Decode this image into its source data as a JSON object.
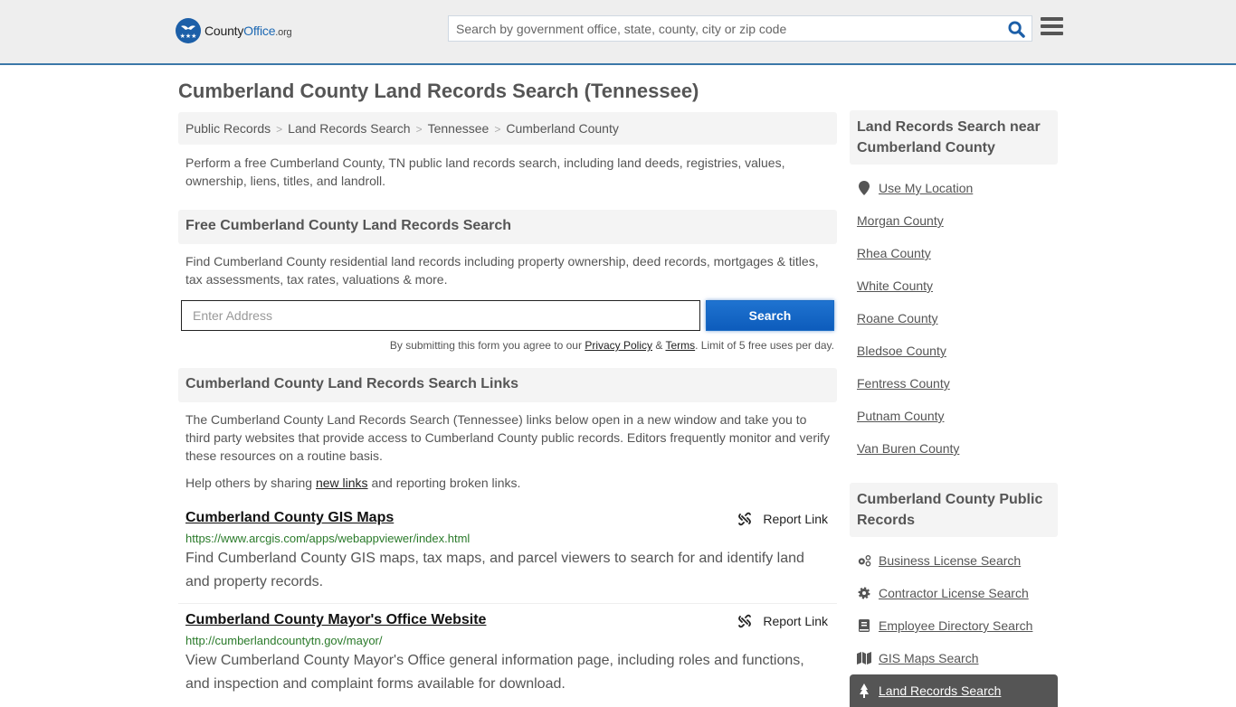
{
  "header": {
    "logo": {
      "county": "County",
      "office": "Office",
      "org": ".org"
    },
    "search_placeholder": "Search by government office, state, county, city or zip code",
    "search_icon": "search-icon",
    "menu_icon": "hamburger-menu-icon"
  },
  "page_title": "Cumberland County Land Records Search (Tennessee)",
  "breadcrumb": [
    {
      "label": "Public Records"
    },
    {
      "label": "Land Records Search"
    },
    {
      "label": "Tennessee"
    },
    {
      "label": "Cumberland County"
    }
  ],
  "intro": "Perform a free Cumberland County, TN public land records search, including land deeds, registries, values, ownership, liens, titles, and landroll.",
  "free_search": {
    "heading": "Free Cumberland County Land Records Search",
    "description": "Find Cumberland County residential land records including property ownership, deed records, mortgages & titles, tax assessments, tax rates, valuations & more.",
    "address_placeholder": "Enter Address",
    "address_value": "",
    "search_button": "Search",
    "disclaimer_prefix": "By submitting this form you agree to our ",
    "privacy_link": "Privacy Policy",
    "amp": " & ",
    "terms_link": "Terms",
    "disclaimer_suffix": ". Limit of 5 free uses per day."
  },
  "links_section": {
    "heading": "Cumberland County Land Records Search Links",
    "description": "The Cumberland County Land Records Search (Tennessee) links below open in a new window and take you to third party websites that provide access to Cumberland County public records. Editors frequently monitor and verify these resources on a routine basis.",
    "help_prefix": "Help others by sharing ",
    "help_link": "new links",
    "help_suffix": " and reporting broken links.",
    "report_label": "Report Link",
    "items": [
      {
        "title": "Cumberland County GIS Maps",
        "url": "https://www.arcgis.com/apps/webappviewer/index.html",
        "description": "Find Cumberland County GIS maps, tax maps, and parcel viewers to search for and identify land and property records."
      },
      {
        "title": "Cumberland County Mayor's Office Website",
        "url": "http://cumberlandcountytn.gov/mayor/",
        "description": "View Cumberland County Mayor's Office general information page, including roles and functions, and inspection and complaint forms available for download."
      }
    ]
  },
  "sidebar": {
    "near_heading": "Land Records Search near Cumberland County",
    "use_location": "Use My Location",
    "nearby": [
      "Morgan County",
      "Rhea County",
      "White County",
      "Roane County",
      "Bledsoe County",
      "Fentress County",
      "Putnam County",
      "Van Buren County"
    ],
    "public_heading": "Cumberland County Public Records",
    "public_records": [
      {
        "label": "Business License Search",
        "icon": "cogs-icon"
      },
      {
        "label": "Contractor License Search",
        "icon": "gear-icon"
      },
      {
        "label": "Employee Directory Search",
        "icon": "book-icon"
      },
      {
        "label": "GIS Maps Search",
        "icon": "map-icon"
      },
      {
        "label": "Land Records Search",
        "icon": "tree-icon",
        "active": true
      }
    ]
  },
  "colors": {
    "accent_blue": "#1c68b3",
    "button_blue": "#1565c8",
    "url_green": "#2a7a2a",
    "header_bg": "#eeeeee",
    "active_bg": "#555555"
  }
}
